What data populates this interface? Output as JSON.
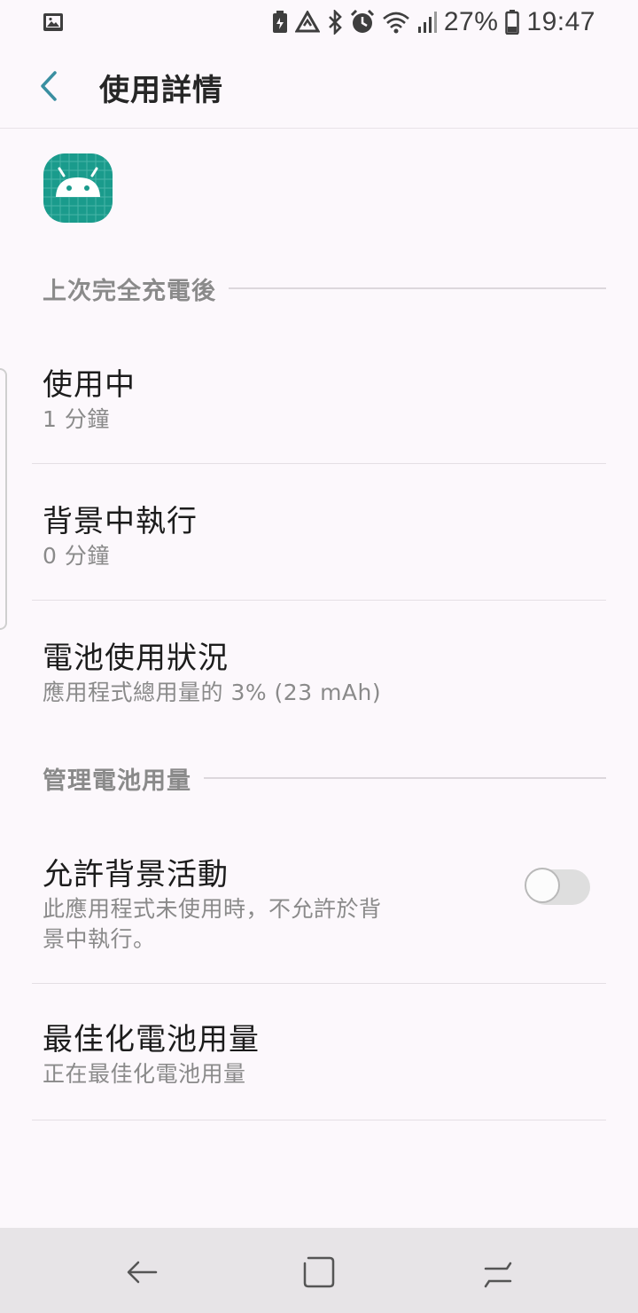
{
  "status_bar": {
    "battery_percent": "27%",
    "time": "19:47",
    "icons": [
      "image-icon",
      "battery-saver-icon",
      "recycle-icon",
      "bluetooth-icon",
      "alarm-icon",
      "wifi-icon",
      "signal-icon",
      "battery-icon"
    ]
  },
  "header": {
    "title": "使用詳情"
  },
  "sections": {
    "since_full_charge": "上次完全充電後",
    "manage_battery": "管理電池用量"
  },
  "items": {
    "foreground": {
      "title": "使用中",
      "value": "1 分鐘"
    },
    "background": {
      "title": "背景中執行",
      "value": "0 分鐘"
    },
    "battery": {
      "title": "電池使用狀況",
      "value": "應用程式總用量的 3% (23 mAh)"
    },
    "allow_background": {
      "title": "允許背景活動",
      "desc_line1": "此應用程式未使用時，不允許於背",
      "desc_line2": "景中執行。",
      "enabled": false
    },
    "optimize": {
      "title": "最佳化電池用量",
      "value": "正在最佳化電池用量"
    }
  },
  "colors": {
    "accent": "#3a8fa1",
    "app_icon": "#1a9b8c",
    "background": "#fcf8fc"
  }
}
